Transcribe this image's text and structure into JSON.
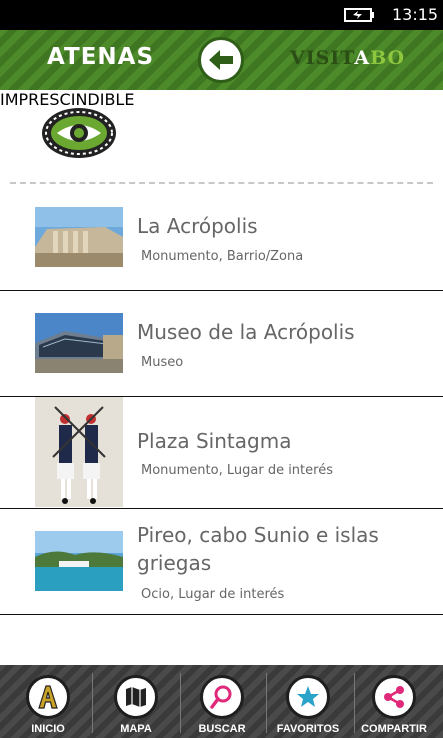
{
  "status_bar": {
    "time": "13:15"
  },
  "header": {
    "city": "ATENAS",
    "brand_prefix": "VISIT",
    "brand_a": "A",
    "brand_suffix": "BO"
  },
  "section": {
    "title": "IMPRESCINDIBLE"
  },
  "items": [
    {
      "title": "La Acrópolis",
      "subtitle": "Monumento, Barrio/Zona"
    },
    {
      "title": "Museo de la Acrópolis",
      "subtitle": "Museo"
    },
    {
      "title": "Plaza Sintagma",
      "subtitle": "Monumento, Lugar de interés"
    },
    {
      "title_line1": "Pireo, cabo Sunio e islas",
      "title_line2": "griegas",
      "subtitle": "Ocio, Lugar de interés"
    }
  ],
  "nav": [
    {
      "label": "INICIO",
      "icon": "a-letter-icon"
    },
    {
      "label": "MAPA",
      "icon": "map-icon"
    },
    {
      "label": "BUSCAR",
      "icon": "search-icon"
    },
    {
      "label": "FAVORITOS",
      "icon": "star-icon"
    },
    {
      "label": "COMPARTIR",
      "icon": "share-icon"
    }
  ],
  "colors": {
    "header_green": "#4d8a2a",
    "accent_pink": "#e0297a",
    "accent_blue": "#2aa3c9",
    "bar_dark": "#3a3a3a"
  }
}
